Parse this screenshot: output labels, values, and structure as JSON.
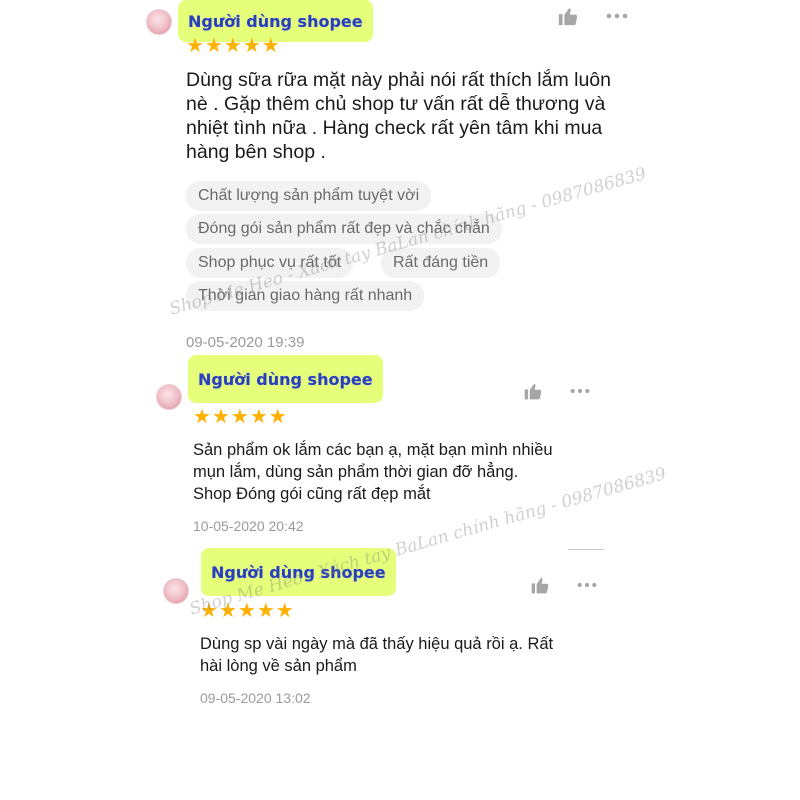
{
  "reviews": [
    {
      "username": "Người dùng shopee",
      "rating": 5,
      "comment_lines": [
        "Dùng sữa rữa mặt này phải nói rất thích lắm luôn",
        "nè . Gặp thêm chủ shop tư vấn rất dễ thương và",
        "nhiệt tình nữa . Hàng check rất yên tâm khi mua",
        "hàng bên shop ."
      ],
      "tags": [
        "Chất lượng sản phẩm tuyệt vời",
        "Đóng gói sản phẩm rất đẹp và chắc chắn",
        "Shop phục vụ rất tốt",
        "Rất đáng tiền",
        "Thời gian giao hàng rất nhanh"
      ],
      "date": "09-05-2020 19:39"
    },
    {
      "username": "Người dùng shopee",
      "rating": 5,
      "comment_lines": [
        "Sản phẩm ok lắm các bạn ạ, mặt bạn mình nhiều",
        "mụn lắm, dùng sản phẩm thời gian đỡ hẳng.",
        "Shop Đóng gói cũng rất đẹp mắt"
      ],
      "date": "10-05-2020 20:42"
    },
    {
      "username": "Người dùng shopee",
      "rating": 5,
      "comment_lines": [
        "Dùng sp vài ngày mà đã thấy hiệu quả rồi ạ. Rất",
        "hài lòng về sản phẩm"
      ],
      "date": "09-05-2020 13:02"
    }
  ],
  "watermarks": [
    "Shop Me Heo - Xách tay BaLan chính hãng - 0987086839",
    "Shop Me Heo - Xách tay BaLan chính hãng - 0987086839"
  ],
  "colors": {
    "badge_bg": "#e6ff7a",
    "badge_text": "#2b3fb8",
    "star": "#ffb100",
    "date": "#9a9a9a",
    "chip_bg": "#f2f2f2"
  },
  "icons": {
    "like": "thumbs-up-icon",
    "more": "more-options-icon"
  }
}
